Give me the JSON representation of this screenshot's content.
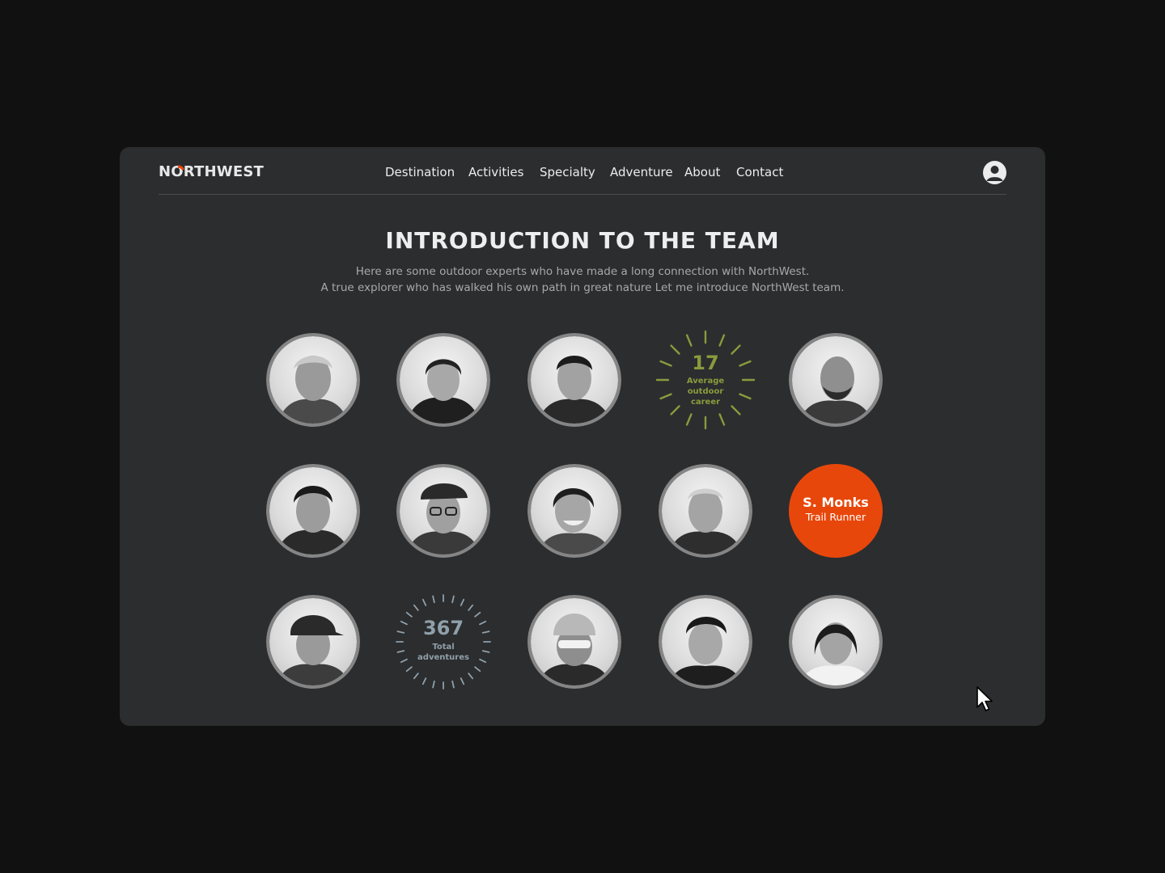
{
  "brand": {
    "name_pre": "N",
    "name_post": "RTHWEST",
    "accent": "#e8470b"
  },
  "nav": {
    "items": [
      {
        "label": "Destination"
      },
      {
        "label": "Activities"
      },
      {
        "label": "Specialty"
      },
      {
        "label": "Adventure"
      },
      {
        "label": "About"
      },
      {
        "label": "Contact"
      }
    ],
    "user_icon": "user-avatar-icon"
  },
  "hero": {
    "title": "INTRODUCTION TO THE TEAM",
    "subtitle_line1": "Here are some outdoor experts who have made a long connection with NorthWest.",
    "subtitle_line2": "A true explorer who has walked his own path in great nature Let me introduce NorthWest team."
  },
  "stats": [
    {
      "value": "17",
      "label_lines": [
        "Average",
        "outdoor",
        "career"
      ],
      "color": "#8a9a3c"
    },
    {
      "value": "367",
      "label_lines": [
        "Total",
        "adventures"
      ],
      "color": "#8fa0aa"
    }
  ],
  "highlight": {
    "name": "S. Monks",
    "role": "Trail Runner",
    "color": "#e8470b"
  },
  "colors": {
    "background": "#111111",
    "card": "#2c2d2f",
    "ring": "#858585"
  }
}
